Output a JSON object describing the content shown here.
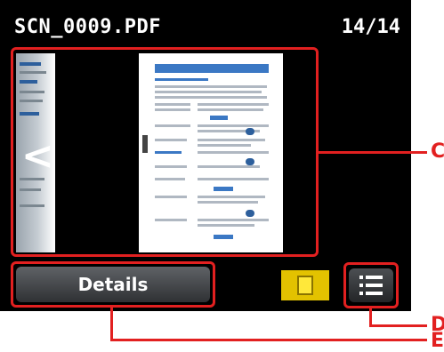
{
  "header": {
    "filename": "SCN_0009.PDF",
    "page_counter": "14/14"
  },
  "preview": {
    "prev_glyph": "<"
  },
  "footer": {
    "details_label": "Details"
  },
  "callouts": {
    "c_label": "C",
    "d_label": "D",
    "e_label": "E"
  },
  "icons": {
    "single_view": "single-page-view-icon",
    "list_view": "list-view-icon"
  },
  "colors": {
    "callout": "#e22020",
    "single_view_active": "#e3c200",
    "screen_bg": "#000000"
  }
}
